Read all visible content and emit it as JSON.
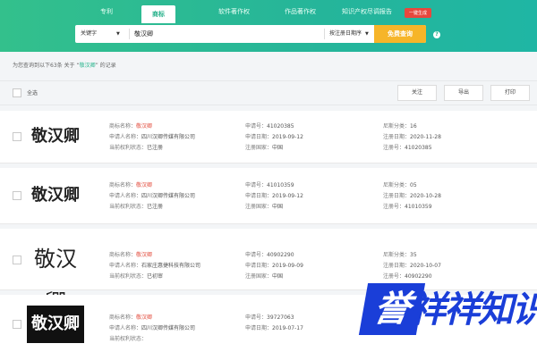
{
  "header": {
    "tabs": [
      {
        "label": "专利"
      },
      {
        "label": "商标"
      },
      {
        "label": "软件著作权"
      },
      {
        "label": "作品著作权"
      },
      {
        "label": "知识产权尽调报告"
      }
    ],
    "badge": "一键生成"
  },
  "search": {
    "field_select": "关键字",
    "query": "敬汉卿",
    "sort_select": "按注册日期序",
    "button": "免费查询",
    "help": "?"
  },
  "summary": {
    "prefix": "为您查询到以下63条 关于 “",
    "keyword": "敬汉卿",
    "suffix": "” 的记录"
  },
  "toolbar": {
    "select_all": "全选",
    "follow": "关注",
    "export": "导出",
    "print": "打印"
  },
  "labels": {
    "name": "商标名称：",
    "applicant": "申请人名称：",
    "status": "当前权利状态：",
    "reg_no": "申请号：",
    "app_date": "申请日期：",
    "country": "注册国家：",
    "class": "尼斯分类：",
    "reg_date": "注册日期：",
    "reg_no2": "注册号："
  },
  "records": [
    {
      "logo": "敬汉卿",
      "name": "敬汉卿",
      "applicant": "四川汉卿传媒有限公司",
      "status": "已注册",
      "app_no": "41020385",
      "app_date": "2019-09-12",
      "country": "中国",
      "class": "16",
      "reg_date": "2020-11-28",
      "reg_no": "41020385"
    },
    {
      "logo": "敬汉卿",
      "name": "敬汉卿",
      "applicant": "四川汉卿传媒有限公司",
      "status": "已注册",
      "app_no": "41010359",
      "app_date": "2019-09-12",
      "country": "中国",
      "class": "05",
      "reg_date": "2020-10-28",
      "reg_no": "41010359"
    },
    {
      "logo": "敬汉卿",
      "name": "敬汉卿",
      "applicant": "石家庄惠捷科技有限公司",
      "status": "已初审",
      "app_no": "40902290",
      "app_date": "2019-09-09",
      "country": "中国",
      "class": "35",
      "reg_date": "2020-10-07",
      "reg_no": "40902290"
    },
    {
      "logo": "敬汉卿",
      "name": "敬汉卿",
      "applicant": "四川汉卿传媒有限公司",
      "status": "",
      "app_no": "39727063",
      "app_date": "2019-07-17",
      "country": "",
      "class": "",
      "reg_date": "",
      "reg_no": ""
    }
  ],
  "watermark": {
    "a": "誉",
    "b": "祥祥知识"
  }
}
